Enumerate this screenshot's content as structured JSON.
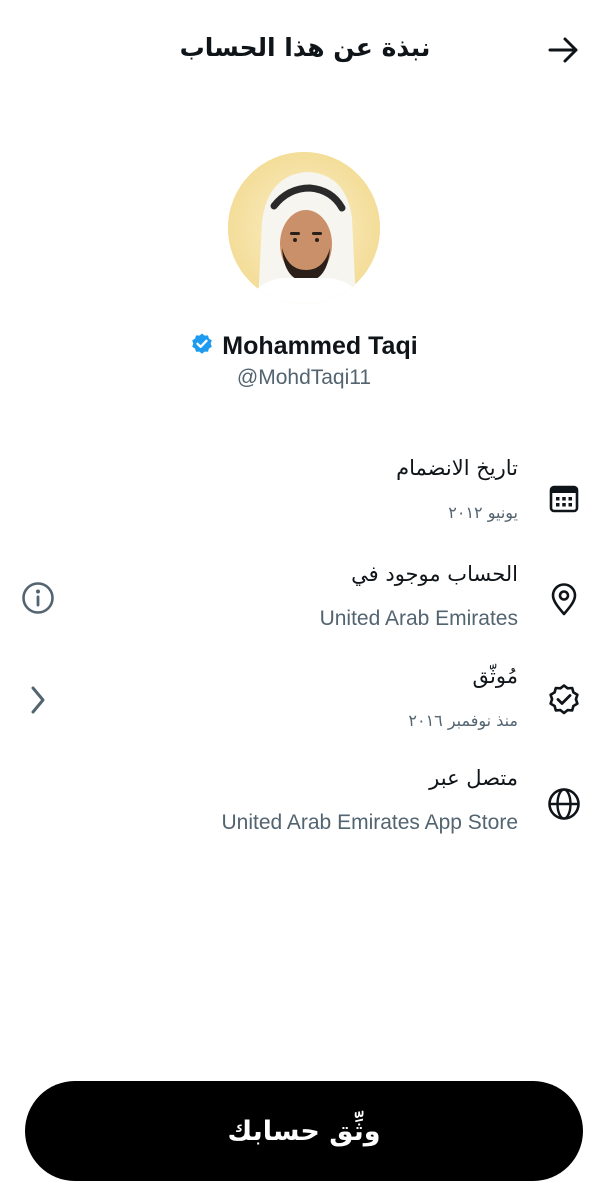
{
  "header": {
    "title": "نبذة عن هذا الحساب",
    "back_icon": "arrow-right-icon"
  },
  "profile": {
    "display_name": "Mohammed Taqi",
    "username": "@MohdTaqi11",
    "verified": true,
    "badge_color": "#1d9bf0"
  },
  "info": {
    "joined": {
      "label": "تاريخ الانضمام",
      "value": "يونيو ٢٠١٢",
      "icon": "calendar-icon"
    },
    "location": {
      "label": "الحساب موجود في",
      "value": "United Arab Emirates",
      "icon": "location-pin-icon",
      "side_icon": "info-icon"
    },
    "verified": {
      "label": "مُوثّق",
      "value": "منذ نوفمبر ٢٠١٦",
      "icon": "verified-badge-icon",
      "side_icon": "chevron-left-icon"
    },
    "connected": {
      "label": "متصل عبر",
      "value": "United Arab Emirates App Store",
      "icon": "globe-icon"
    }
  },
  "actions": {
    "verify_label": "وثِّق حسابك"
  },
  "colors": {
    "text_primary": "#0f1419",
    "text_secondary": "#536471",
    "button_bg": "#000000"
  }
}
